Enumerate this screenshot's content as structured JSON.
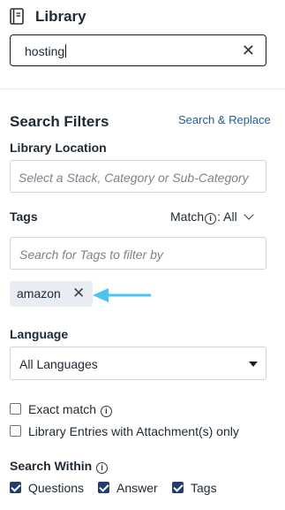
{
  "header": {
    "title": "Library",
    "icon": "book-icon"
  },
  "search": {
    "value": "hosting",
    "clear_icon": "close-icon"
  },
  "filters": {
    "title": "Search Filters",
    "replace_link": "Search & Replace",
    "library_location": {
      "label": "Library Location",
      "placeholder": "Select a Stack, Category or Sub-Category"
    },
    "tags": {
      "label": "Tags",
      "match_label": "Match",
      "match_value": "All",
      "placeholder": "Search for Tags to filter by",
      "selected": [
        {
          "label": "amazon"
        }
      ],
      "arrow_color": "#4cc3ee"
    },
    "language": {
      "label": "Language",
      "selected": "All Languages"
    },
    "options": {
      "exact_match": {
        "label": "Exact match",
        "checked": false
      },
      "attachments_only": {
        "label": "Library Entries with Attachment(s) only",
        "checked": false
      }
    },
    "search_within": {
      "label": "Search Within",
      "items": [
        {
          "label": "Questions",
          "checked": true
        },
        {
          "label": "Answer",
          "checked": true
        },
        {
          "label": "Tags",
          "checked": true
        }
      ]
    }
  },
  "colors": {
    "accent": "#1f3f74",
    "link": "#1f5fa0",
    "chip_bg": "#e9ecf2"
  }
}
